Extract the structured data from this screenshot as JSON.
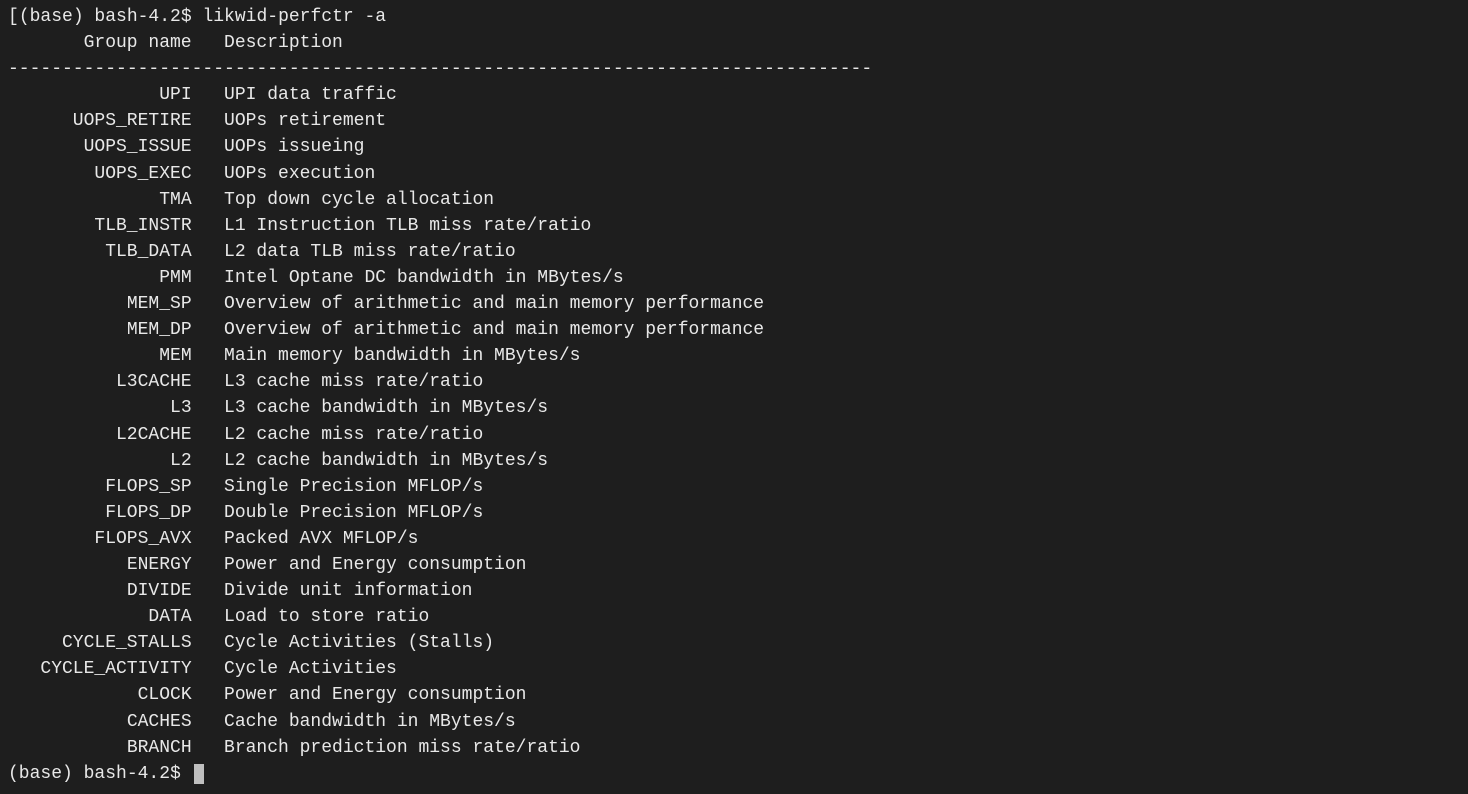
{
  "prompt1": "(base) bash-4.2$ ",
  "command": "likwid-perfctr -a",
  "header": {
    "name": "Group name",
    "description": "Description"
  },
  "separator": "--------------------------------------------------------------------------------",
  "rows": [
    {
      "name": "UPI",
      "description": "UPI data traffic"
    },
    {
      "name": "UOPS_RETIRE",
      "description": "UOPs retirement"
    },
    {
      "name": "UOPS_ISSUE",
      "description": "UOPs issueing"
    },
    {
      "name": "UOPS_EXEC",
      "description": "UOPs execution"
    },
    {
      "name": "TMA",
      "description": "Top down cycle allocation"
    },
    {
      "name": "TLB_INSTR",
      "description": "L1 Instruction TLB miss rate/ratio"
    },
    {
      "name": "TLB_DATA",
      "description": "L2 data TLB miss rate/ratio"
    },
    {
      "name": "PMM",
      "description": "Intel Optane DC bandwidth in MBytes/s"
    },
    {
      "name": "MEM_SP",
      "description": "Overview of arithmetic and main memory performance"
    },
    {
      "name": "MEM_DP",
      "description": "Overview of arithmetic and main memory performance"
    },
    {
      "name": "MEM",
      "description": "Main memory bandwidth in MBytes/s"
    },
    {
      "name": "L3CACHE",
      "description": "L3 cache miss rate/ratio"
    },
    {
      "name": "L3",
      "description": "L3 cache bandwidth in MBytes/s"
    },
    {
      "name": "L2CACHE",
      "description": "L2 cache miss rate/ratio"
    },
    {
      "name": "L2",
      "description": "L2 cache bandwidth in MBytes/s"
    },
    {
      "name": "FLOPS_SP",
      "description": "Single Precision MFLOP/s"
    },
    {
      "name": "FLOPS_DP",
      "description": "Double Precision MFLOP/s"
    },
    {
      "name": "FLOPS_AVX",
      "description": "Packed AVX MFLOP/s"
    },
    {
      "name": "ENERGY",
      "description": "Power and Energy consumption"
    },
    {
      "name": "DIVIDE",
      "description": "Divide unit information"
    },
    {
      "name": "DATA",
      "description": "Load to store ratio"
    },
    {
      "name": "CYCLE_STALLS",
      "description": "Cycle Activities (Stalls)"
    },
    {
      "name": "CYCLE_ACTIVITY",
      "description": "Cycle Activities"
    },
    {
      "name": "CLOCK",
      "description": "Power and Energy consumption"
    },
    {
      "name": "CACHES",
      "description": "Cache bandwidth in MBytes/s"
    },
    {
      "name": "BRANCH",
      "description": "Branch prediction miss rate/ratio"
    }
  ],
  "prompt2": "(base) bash-4.2$ "
}
